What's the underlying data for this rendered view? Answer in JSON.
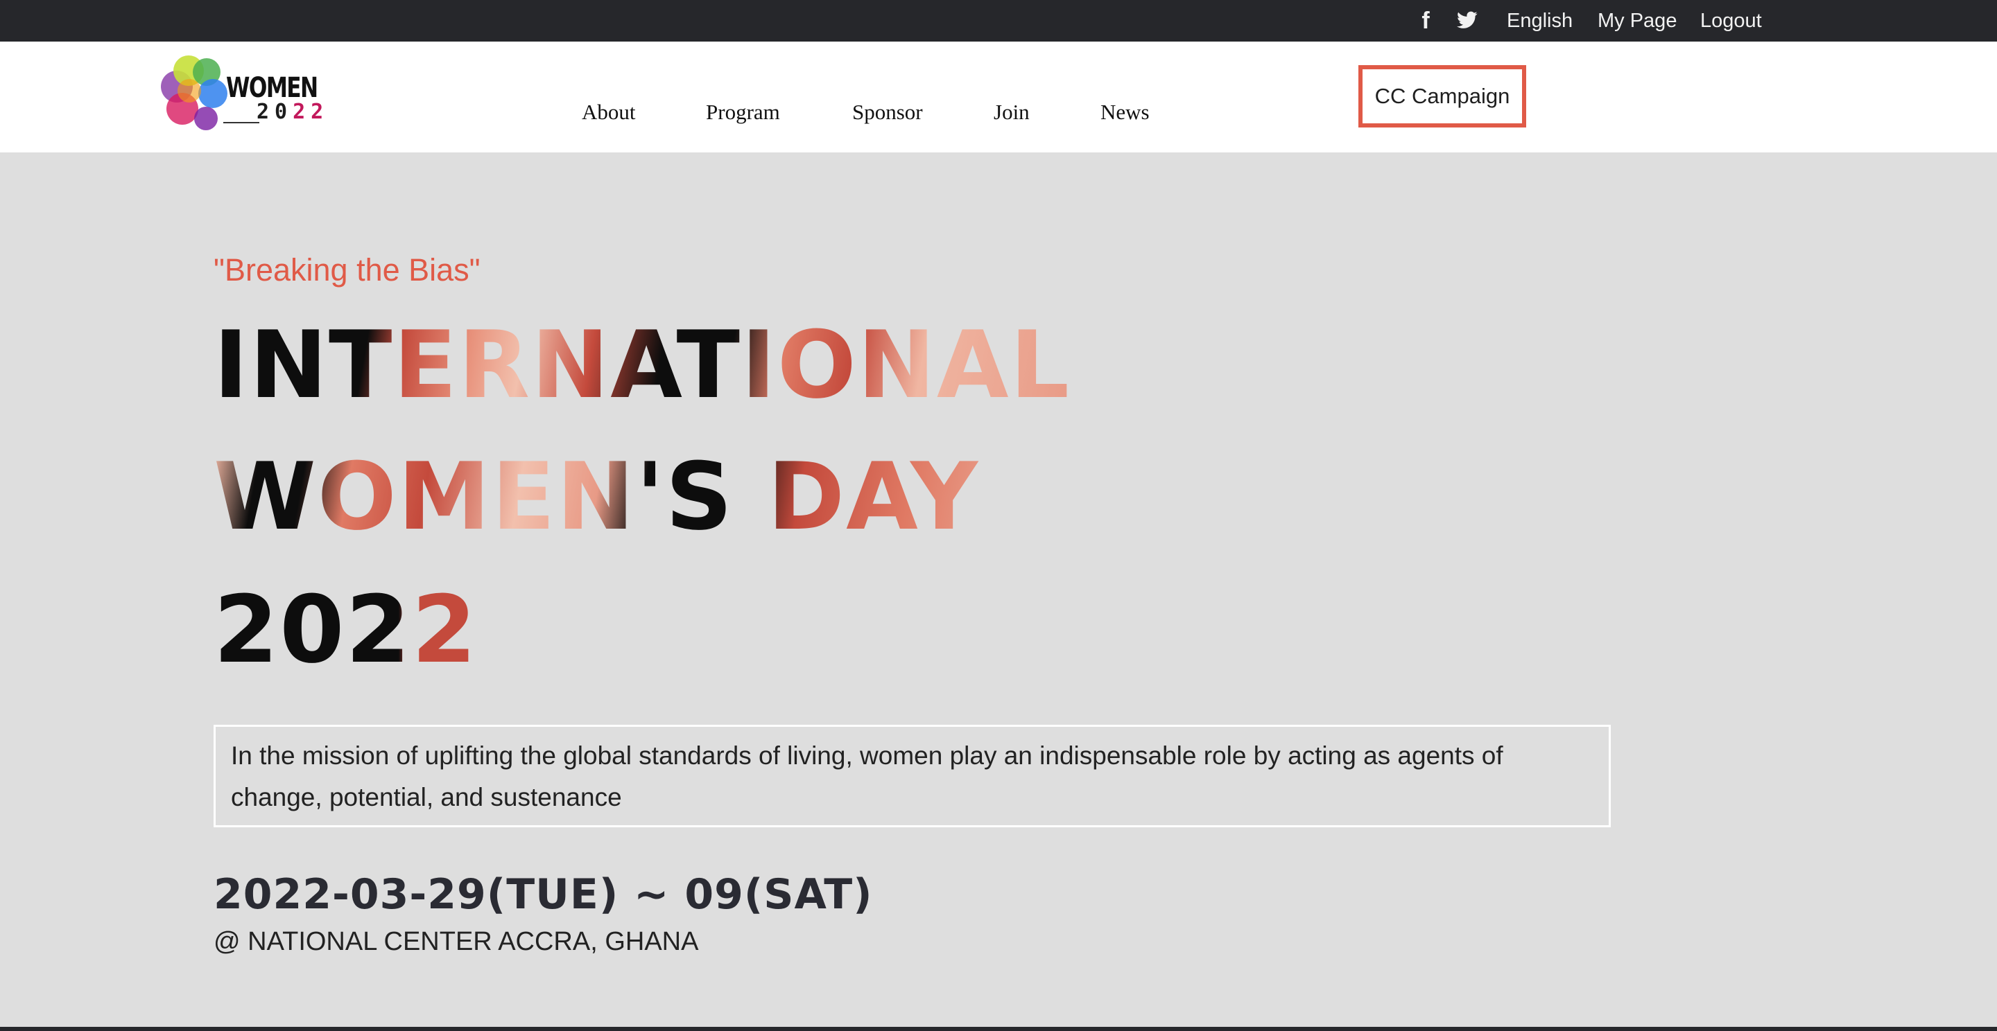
{
  "topbar": {
    "facebook_icon_glyph": "f",
    "language": "English",
    "my_page": "My Page",
    "logout": "Logout"
  },
  "logo": {
    "word": "WOMEN",
    "year_prefix": "20",
    "year_suffix": "22"
  },
  "nav": {
    "items": [
      "About",
      "Program",
      "Sponsor",
      "Join",
      "News"
    ],
    "cta": "CC Campaign"
  },
  "hero": {
    "tagline": "\"Breaking the Bias\"",
    "title_lines": [
      "INTERNATIONAL",
      "WOMEN'S DAY",
      "2022"
    ],
    "description": "In the mission of uplifting the global standards of living, women play an indispensable role by acting as agents of change, potential, and sustenance",
    "dates": "2022-03-29(TUE) ~ 09(SAT)",
    "venue": "@ NATIONAL CENTER ACCRA, GHANA"
  },
  "colors": {
    "accent": "#e05a47",
    "topbar_bg": "#26272b",
    "page_bg": "#dedede"
  }
}
